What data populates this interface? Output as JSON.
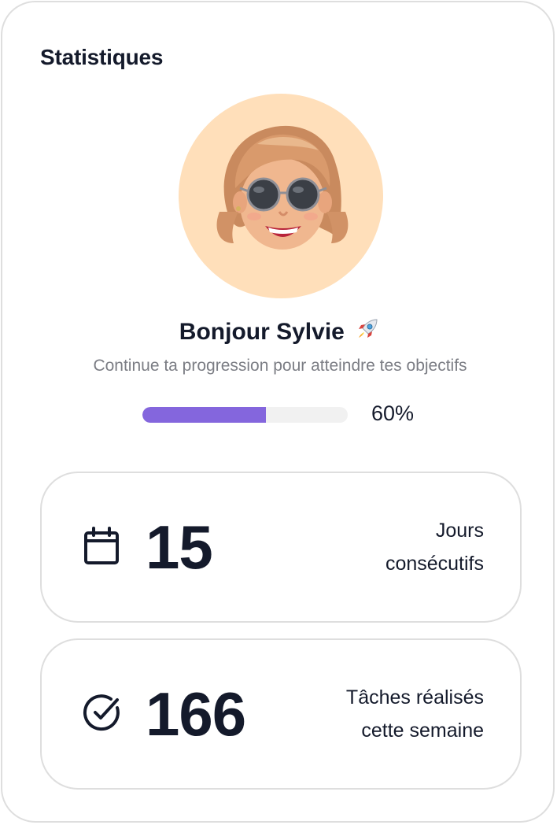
{
  "card": {
    "title": "Statistiques"
  },
  "profile": {
    "greeting": "Bonjour Sylvie",
    "greeting_icon": "rocket-icon",
    "subtitle": "Continue ta progression pour atteindre tes objectifs",
    "avatar_bg": "#ffdfba"
  },
  "progress": {
    "value": 0.6,
    "label": "60%",
    "fill_color": "#8466dd",
    "track_color": "#f1f1f1"
  },
  "stats": [
    {
      "icon": "calendar-icon",
      "value": "15",
      "label_line1": "Jours",
      "label_line2": "consécutifs"
    },
    {
      "icon": "check-circle-icon",
      "value": "166",
      "label_line1": "Tâches réalisés",
      "label_line2": "cette semaine"
    }
  ]
}
